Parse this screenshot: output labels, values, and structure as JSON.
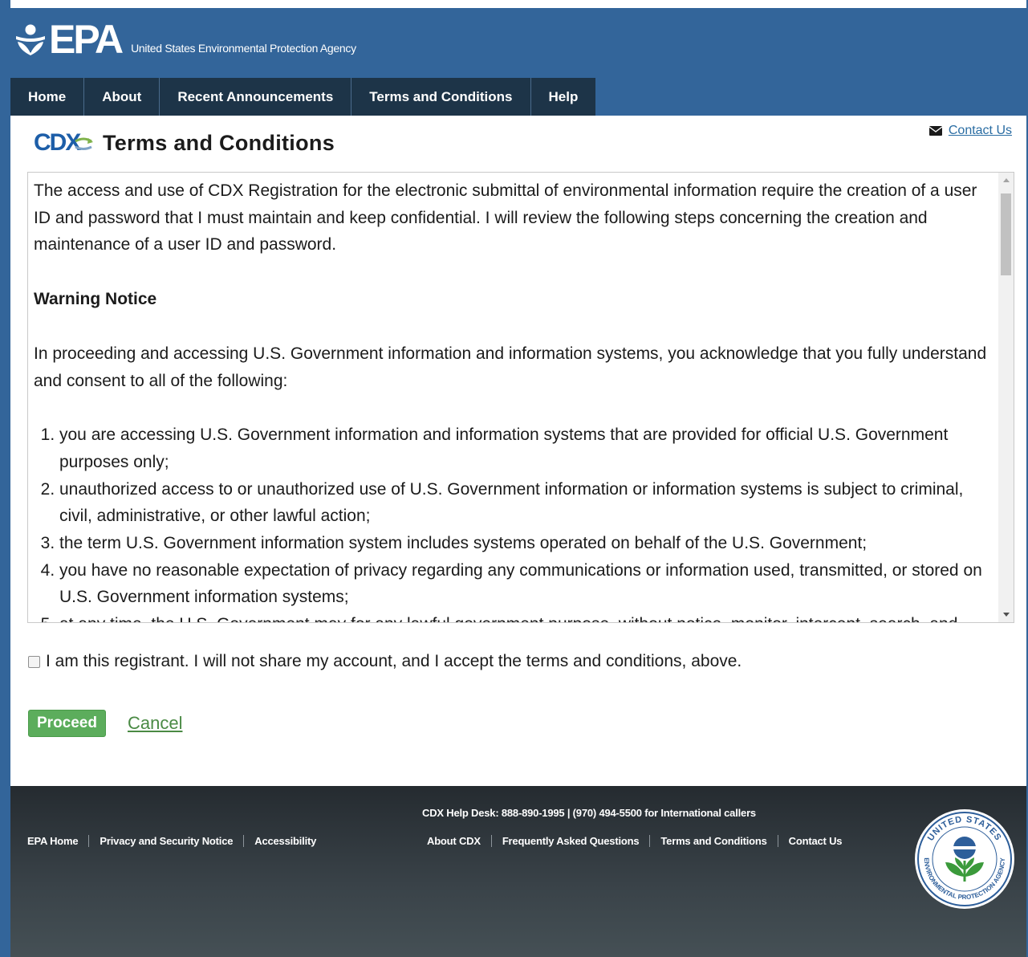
{
  "header": {
    "logo_text": "EPA",
    "agency_name": "United States Environmental Protection Agency"
  },
  "nav": {
    "items": [
      {
        "label": "Home"
      },
      {
        "label": "About"
      },
      {
        "label": "Recent Announcements"
      },
      {
        "label": "Terms and Conditions"
      },
      {
        "label": "Help"
      }
    ]
  },
  "page": {
    "cdx_logo": "CDX",
    "title": "Terms and Conditions",
    "contact_link": "Contact Us"
  },
  "terms": {
    "intro": "The access and use of CDX Registration for the electronic submittal of environmental information require the creation of a user ID and password that I must maintain and keep confidential. I will review the following steps concerning the creation and maintenance of a user ID and password.",
    "warning_heading": "Warning Notice",
    "consent_intro": "In proceeding and accessing U.S. Government information and information systems, you acknowledge that you fully understand and consent to all of the following:",
    "items": [
      "you are accessing U.S. Government information and information systems that are provided for official U.S. Government purposes only;",
      "unauthorized access to or unauthorized use of U.S. Government information or information systems is subject to criminal, civil, administrative, or other lawful action;",
      "the term U.S. Government information system includes systems operated on behalf of the U.S. Government;",
      "you have no reasonable expectation of privacy regarding any communications or information used, transmitted, or stored on U.S. Government information systems;",
      "at any time, the U.S. Government may for any lawful government purpose, without notice, monitor, intercept, search, and seize any authorized or unauthorized communication to or from U.S. Government information systems or information used or stored on U.S. Government information systems;"
    ]
  },
  "form": {
    "accept_label": "I am this registrant. I will not share my account, and I accept the terms and conditions, above.",
    "accept_checked": false,
    "proceed_label": "Proceed",
    "cancel_label": "Cancel"
  },
  "footer": {
    "helpdesk": "CDX Help Desk: 888-890-1995 | (970) 494-5500 for International callers",
    "left_links": [
      "EPA Home",
      "Privacy and Security Notice",
      "Accessibility"
    ],
    "right_links": [
      "About CDX",
      "Frequently Asked Questions",
      "Terms and Conditions",
      "Contact Us"
    ],
    "seal_top_text": "UNITED STATES",
    "seal_bottom_text": "ENVIRONMENTAL PROTECTION AGENCY"
  },
  "colors": {
    "header_bg": "#33659a",
    "nav_bg": "#1d3448",
    "proceed_green": "#5cad5c",
    "link_blue": "#2a6da3",
    "footer_bg": "#2f373c"
  },
  "icons": [
    "epa-flower-logo-icon",
    "envelope-icon",
    "scroll-up-arrow-icon",
    "scroll-down-arrow-icon",
    "epa-seal-icon",
    "cdx-arrow-icon"
  ]
}
